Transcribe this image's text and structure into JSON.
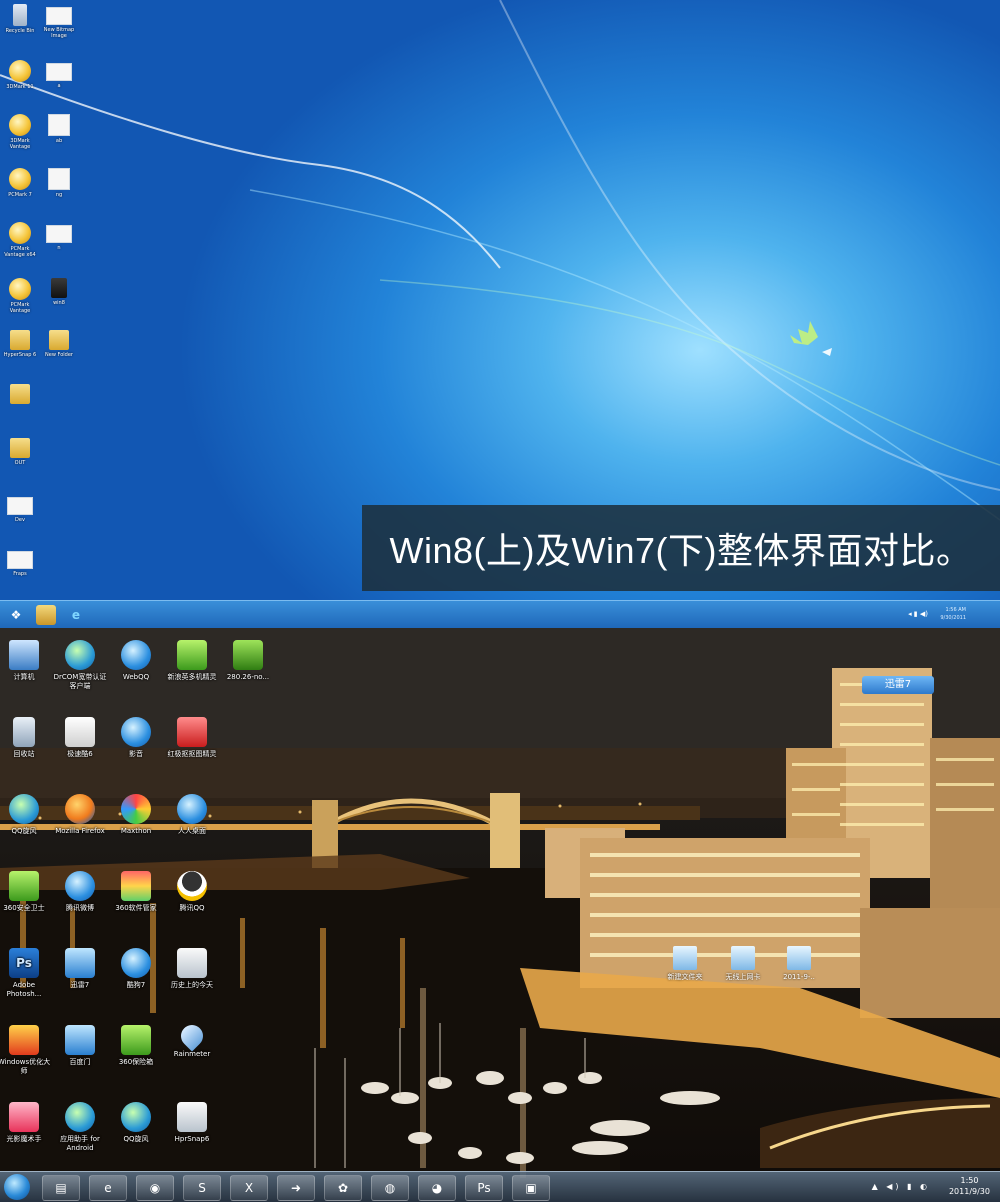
{
  "caption": "Win8(上)及Win7(下)整体界面对比。",
  "win8": {
    "desktop_icons": [
      {
        "label": "Recycle Bin",
        "icon": "recycle-bin-icon"
      },
      {
        "label": "New Bitmap Image",
        "icon": "bitmap-file-icon"
      },
      {
        "label": "3DMark 11",
        "icon": "3dmark-icon"
      },
      {
        "label": "a",
        "icon": "bitmap-file-icon"
      },
      {
        "label": "3DMark Vantage",
        "icon": "3dmark-icon"
      },
      {
        "label": "ab",
        "icon": "file-icon"
      },
      {
        "label": "PCMark 7",
        "icon": "pcmark-icon"
      },
      {
        "label": "ng",
        "icon": "file-icon"
      },
      {
        "label": "PCMark Vantage x64",
        "icon": "pcmark-icon"
      },
      {
        "label": "n",
        "icon": "bitmap-file-icon"
      },
      {
        "label": "PCMark Vantage",
        "icon": "pcmark-icon"
      },
      {
        "label": "win8",
        "icon": "dark-file-icon"
      },
      {
        "label": "HyperSnap 6",
        "icon": "folder-icon"
      },
      {
        "label": "New Folder",
        "icon": "folder-icon"
      },
      {
        "label": "",
        "icon": "folder-icon"
      },
      {
        "label": "OUT",
        "icon": "folder-icon"
      },
      {
        "label": "Dev",
        "icon": "bitmap-file-icon"
      },
      {
        "label": "Fraps",
        "icon": "fraps-icon"
      }
    ],
    "taskbar": {
      "tray_time": "1:56 AM",
      "tray_date": "9/30/2011"
    }
  },
  "win7": {
    "badge": "迅雷7",
    "desktop_icons": [
      {
        "label": "计算机",
        "icon": "computer-icon"
      },
      {
        "label": "DrCOM宽带认证客户端",
        "icon": "drcom-icon"
      },
      {
        "label": "WebQQ",
        "icon": "webqq-icon"
      },
      {
        "label": "新浪英多机精灵",
        "icon": "sina-icon"
      },
      {
        "label": "280.26-no...",
        "icon": "nvidia-icon"
      },
      {
        "label": "回收站",
        "icon": "recycle-bin-icon"
      },
      {
        "label": "极速酷6",
        "icon": "ku6-icon"
      },
      {
        "label": "影音",
        "icon": "player-icon"
      },
      {
        "label": "红极抠抠图精灵",
        "icon": "red-app-icon"
      },
      {
        "label": "",
        "icon": "blank-icon"
      },
      {
        "label": "QQ旋风",
        "icon": "qq-whirlwind-icon"
      },
      {
        "label": "Mozilla Firefox",
        "icon": "firefox-icon"
      },
      {
        "label": "Maxthon",
        "icon": "maxthon-icon"
      },
      {
        "label": "人人桌面",
        "icon": "renren-icon"
      },
      {
        "label": "",
        "icon": "blank-icon"
      },
      {
        "label": "360安全卫士",
        "icon": "app-green-icon"
      },
      {
        "label": "腾讯微博",
        "icon": "weibo-icon"
      },
      {
        "label": "360软件管家",
        "icon": "app-kite-icon"
      },
      {
        "label": "腾讯QQ",
        "icon": "qq-icon"
      },
      {
        "label": "",
        "icon": "blank-icon"
      },
      {
        "label": "Adobe Photosh...",
        "icon": "photoshop-icon"
      },
      {
        "label": "迅雷7",
        "icon": "thunder-icon"
      },
      {
        "label": "酷狗7",
        "icon": "kugou-icon"
      },
      {
        "label": "历史上的今天",
        "icon": "calendar-icon"
      },
      {
        "label": "",
        "icon": "blank-icon"
      },
      {
        "label": "Windows优化大师",
        "icon": "optimizer-icon"
      },
      {
        "label": "百度门",
        "icon": "bird-icon"
      },
      {
        "label": "360保险箱",
        "icon": "app-green-icon"
      },
      {
        "label": "Rainmeter",
        "icon": "rainmeter-icon"
      },
      {
        "label": "",
        "icon": "blank-icon"
      },
      {
        "label": "光影魔术手",
        "icon": "pink-app-icon"
      },
      {
        "label": "应用助手 for Android",
        "icon": "android-helper-icon"
      },
      {
        "label": "QQ旋风",
        "icon": "qq-whirlwind-icon"
      },
      {
        "label": "HprSnap6",
        "icon": "hypersnap-icon"
      }
    ],
    "city_icons": [
      {
        "label": "新建文件夹",
        "icon": "file-icon"
      },
      {
        "label": "无线上网卡",
        "icon": "file-icon"
      },
      {
        "label": "2011-9-..",
        "icon": "file-icon"
      }
    ],
    "taskbar": {
      "apps": [
        {
          "icon": "explorer-icon",
          "glyph": "▤"
        },
        {
          "icon": "ie-icon",
          "glyph": "e"
        },
        {
          "icon": "chrome-icon",
          "glyph": "◉"
        },
        {
          "icon": "app-s-icon",
          "glyph": "S"
        },
        {
          "icon": "excel-icon",
          "glyph": "X"
        },
        {
          "icon": "arrow-app-icon",
          "glyph": "➜"
        },
        {
          "icon": "leaf-app-icon",
          "glyph": "✿"
        },
        {
          "icon": "globe-app-icon",
          "glyph": "◍"
        },
        {
          "icon": "qq-icon",
          "glyph": "◕"
        },
        {
          "icon": "photoshop-icon",
          "glyph": "Ps"
        },
        {
          "icon": "window-app-icon",
          "glyph": "▣"
        }
      ],
      "clock_time": "1:50",
      "clock_date": "2011/9/30"
    }
  }
}
